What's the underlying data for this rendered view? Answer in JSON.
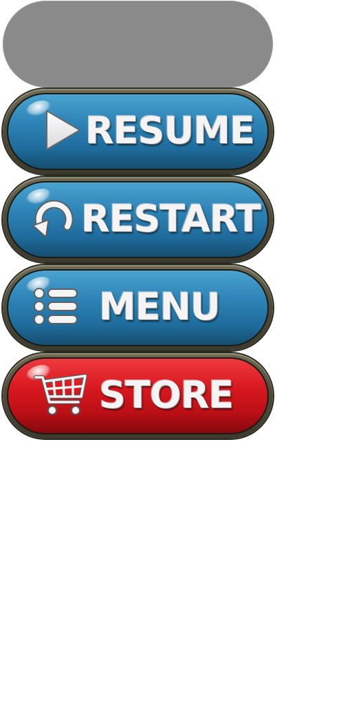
{
  "buttons": [
    {
      "id": "resume",
      "label": "RESUME",
      "icon": "play-icon",
      "color": "#2f86b8"
    },
    {
      "id": "restart",
      "label": "RESTART",
      "icon": "restart-icon",
      "color": "#2f86b8"
    },
    {
      "id": "menu",
      "label": "MENU",
      "icon": "list-icon",
      "color": "#2f86b8"
    },
    {
      "id": "store",
      "label": "STORE",
      "icon": "cart-icon",
      "color": "#d8181f"
    }
  ],
  "placeholder_color": "#8a8a8a",
  "bezel_color": "#4f4c3a"
}
